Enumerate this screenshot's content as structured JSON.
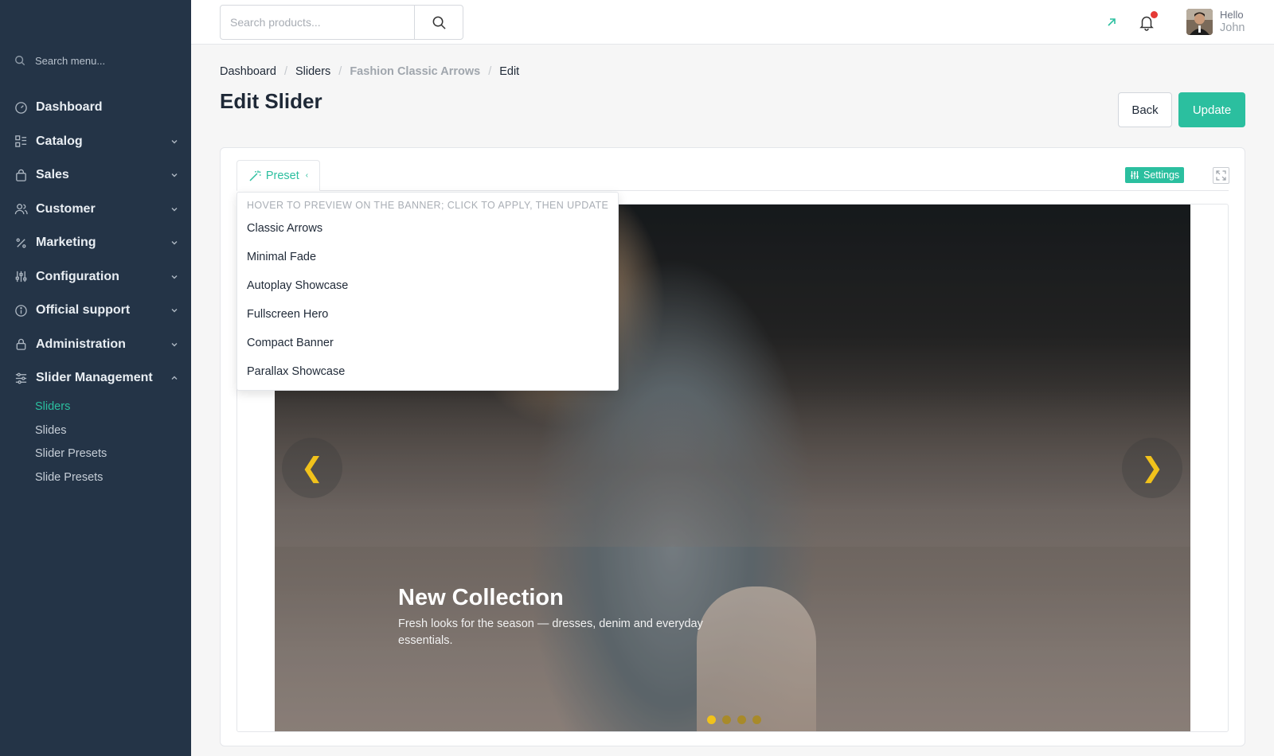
{
  "sidebar": {
    "search_placeholder": "Search menu...",
    "items": [
      {
        "label": "Dashboard",
        "icon": "dashboard-icon",
        "chevron": false
      },
      {
        "label": "Catalog",
        "icon": "catalog-icon",
        "chevron": true
      },
      {
        "label": "Sales",
        "icon": "shopping-bag-icon",
        "chevron": true
      },
      {
        "label": "Customer",
        "icon": "users-icon",
        "chevron": true
      },
      {
        "label": "Marketing",
        "icon": "percent-icon",
        "chevron": true
      },
      {
        "label": "Configuration",
        "icon": "sliders-icon",
        "chevron": true
      },
      {
        "label": "Official support",
        "icon": "info-icon",
        "chevron": true
      },
      {
        "label": "Administration",
        "icon": "lock-icon",
        "chevron": true
      },
      {
        "label": "Slider Management",
        "icon": "slider-management-icon",
        "chevron": true,
        "expanded": true
      }
    ],
    "submenu": [
      {
        "label": "Sliders",
        "active": true
      },
      {
        "label": "Slides",
        "active": false
      },
      {
        "label": "Slider Presets",
        "active": false
      },
      {
        "label": "Slide Presets",
        "active": false
      }
    ]
  },
  "topbar": {
    "search_placeholder": "Search products...",
    "user": {
      "greeting": "Hello",
      "name": "John"
    }
  },
  "breadcrumb": {
    "items": [
      "Dashboard",
      "Sliders",
      "Fashion Classic Arrows",
      "Edit"
    ]
  },
  "page": {
    "title": "Edit Slider",
    "back_label": "Back",
    "update_label": "Update"
  },
  "editor": {
    "preset_tab_label": "Preset",
    "settings_label": "Settings"
  },
  "preset_dropdown": {
    "hint": "Hover to preview on the banner; click to apply, then update",
    "options": [
      "Classic Arrows",
      "Minimal Fade",
      "Autoplay Showcase",
      "Fullscreen Hero",
      "Compact Banner",
      "Parallax Showcase"
    ]
  },
  "banner": {
    "title": "New Collection",
    "subtitle": "Fresh looks for the season — dresses, denim and everyday essentials.",
    "prev_glyph": "❮",
    "next_glyph": "❯",
    "dots": 4,
    "active_dot": 0
  },
  "colors": {
    "accent": "#2bbf9f",
    "sidebar_bg": "#243447",
    "arrow_color": "#f1c21b",
    "notification_dot": "#e53935"
  }
}
